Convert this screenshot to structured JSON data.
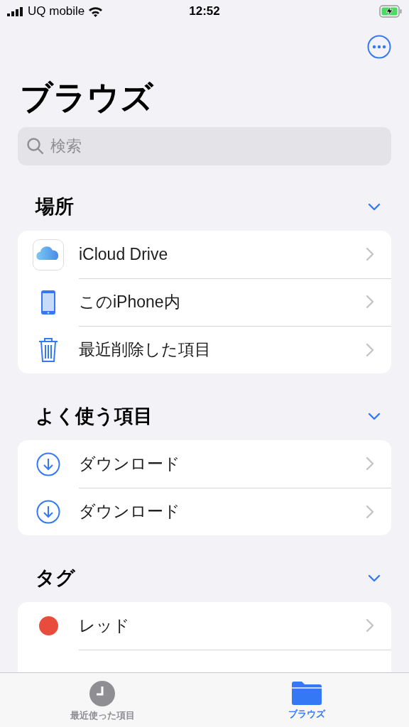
{
  "status_bar": {
    "carrier": "UQ mobile",
    "time": "12:52",
    "charging": true
  },
  "title": "ブラウズ",
  "search": {
    "placeholder": "検索"
  },
  "sections": [
    {
      "title": "場所",
      "expanded": true,
      "items": [
        {
          "kind": "cloud",
          "label": "iCloud Drive"
        },
        {
          "kind": "phone",
          "label": "このiPhone内"
        },
        {
          "kind": "trash",
          "label": "最近削除した項目"
        }
      ]
    },
    {
      "title": "よく使う項目",
      "expanded": true,
      "items": [
        {
          "kind": "download",
          "label": "ダウンロード"
        },
        {
          "kind": "download",
          "label": "ダウンロード"
        }
      ]
    },
    {
      "title": "タグ",
      "expanded": true,
      "items": [
        {
          "kind": "tag",
          "label": "レッド",
          "color": "#e74c3c"
        }
      ]
    }
  ],
  "tab_bar": [
    {
      "kind": "recents",
      "label": "最近使った項目",
      "selected": false
    },
    {
      "kind": "browse",
      "label": "ブラウズ",
      "selected": true
    }
  ]
}
